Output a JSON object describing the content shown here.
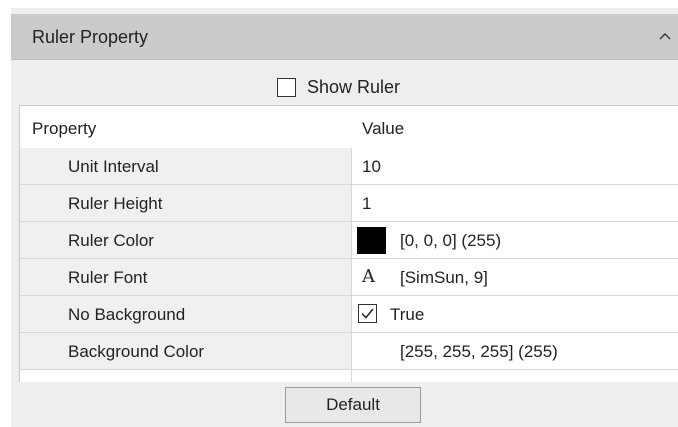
{
  "panel": {
    "title": "Ruler Property",
    "collapse_icon": "chevron-up-icon"
  },
  "show_ruler": {
    "label": "Show Ruler",
    "checked": false
  },
  "grid": {
    "columns": [
      "Property",
      "Value"
    ],
    "rows": [
      {
        "name": "Unit Interval",
        "value": "10"
      },
      {
        "name": "Ruler Height",
        "value": "1"
      },
      {
        "name": "Ruler Color",
        "value": "[0, 0, 0] (255)",
        "swatch": "#000000"
      },
      {
        "name": "Ruler Font",
        "value": "[SimSun, 9]",
        "icon": "font-icon",
        "icon_glyph": "A"
      },
      {
        "name": "No Background",
        "value": "True",
        "checked": true
      },
      {
        "name": "Background Color",
        "value": "[255, 255, 255] (255)",
        "swatch": "#ffffff"
      }
    ]
  },
  "buttons": {
    "default_label": "Default"
  }
}
